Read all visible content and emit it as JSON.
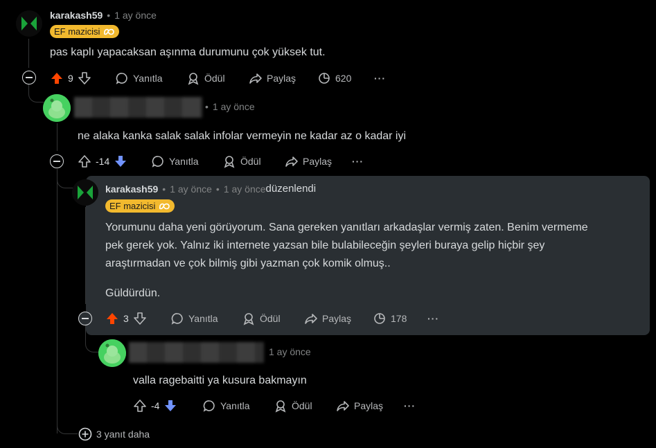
{
  "colors": {
    "upvote": "#ff4500",
    "downvote": "#7193ff",
    "flair_bg": "#f2b92e",
    "highlight_bg": "#2a2f33"
  },
  "comments": [
    {
      "username": "karakash59",
      "sep": "•",
      "time": "1 ay önce",
      "flair": "EF mazicisi",
      "flair_icon": "infinity-icon",
      "text": "pas kaplı yapacaksan aşınma durumunu çok yüksek tut.",
      "score": "9",
      "vote_state": "upvoted",
      "actions": {
        "reply": "Yanıtla",
        "award": "Ödül",
        "share": "Paylaş",
        "views": "620",
        "more": "···"
      }
    },
    {
      "username": "",
      "sep": "•",
      "time": "1 ay önce",
      "text": "ne alaka kanka salak salak infolar vermeyin ne kadar az o kadar iyi",
      "score": "-14",
      "vote_state": "downvoted",
      "actions": {
        "reply": "Yanıtla",
        "award": "Ödül",
        "share": "Paylaş",
        "more": "···"
      }
    },
    {
      "username": "karakash59",
      "sep": "•",
      "time": "1 ay önce",
      "sep2": "•",
      "edited_time": "1 ay önce",
      "edited_label": "düzenlendi",
      "flair": "EF mazicisi",
      "flair_icon": "infinity-icon",
      "text_p1": "Yorumunu daha yeni görüyorum. Sana gereken yanıtları arkadaşlar vermiş zaten. Benim vermeme",
      "text_p2": "pek gerek yok. Yalnız iki internete yazsan bile bulabileceğin şeyleri buraya gelip hiçbir şey",
      "text_p3": "araştırmadan ve çok bilmiş gibi yazman çok komik olmuş..",
      "text_p4": "Güldürdün.",
      "score": "3",
      "vote_state": "upvoted",
      "actions": {
        "reply": "Yanıtla",
        "award": "Ödül",
        "share": "Paylaş",
        "views": "178",
        "more": "···"
      }
    },
    {
      "username": "",
      "time": "1 ay önce",
      "text": "valla ragebaitti ya kusura bakmayın",
      "score": "-4",
      "vote_state": "downvoted",
      "actions": {
        "reply": "Yanıtla",
        "award": "Ödül",
        "share": "Paylaş",
        "more": "···"
      }
    }
  ],
  "more_replies": "3 yanıt daha"
}
